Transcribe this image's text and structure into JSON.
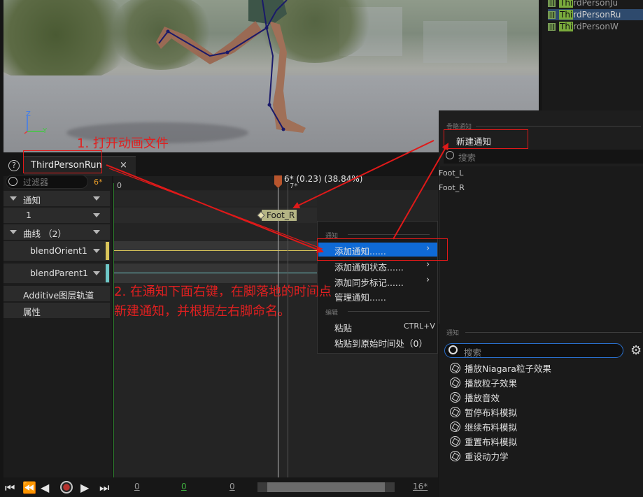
{
  "outliner": {
    "items": [
      {
        "prefix": "Thi",
        "rest": "rdPersonJu",
        "selected": false
      },
      {
        "prefix": "Thi",
        "rest": "rdPersonRu",
        "selected": true
      },
      {
        "prefix": "Thi",
        "rest": "rdPersonW",
        "selected": false
      }
    ]
  },
  "viewport": {
    "axis_z": "Z",
    "axis_y": "Y"
  },
  "tab": {
    "help": "?",
    "label": "ThirdPersonRun",
    "close": "×"
  },
  "timeline": {
    "filter_placeholder": "过滤器",
    "frame_count": "6*",
    "ruler_start": "0",
    "ruler_next": "7*",
    "scrub_label": "6* (0.23) (38.84%)",
    "tracks": {
      "notifies_label": "通知",
      "notify_track_1": "1",
      "curves_label": "曲线 （2）",
      "curve_1": "blendOrient1",
      "curve_2": "blendParent1",
      "additive": "Additive图层轨道",
      "attributes": "属性"
    },
    "notify_marker": "Foot_R",
    "curve_colors": {
      "curve_1": "#d8c45a",
      "curve_2": "#6ec7c7"
    }
  },
  "transport": {
    "num_1": "0",
    "num_2": "0",
    "num_3": "0",
    "num_end": "16*"
  },
  "context_menu": {
    "section_notify": "通知",
    "add_notify": "添加通知......",
    "add_notify_state": "添加通知状态......",
    "add_sync_marker": "添加同步标记......",
    "manage_notifies": "管理通知......",
    "section_edit": "编辑",
    "paste": "粘贴",
    "paste_shortcut": "CTRL+V",
    "paste_original_time": "粘贴到原始时间处（0）"
  },
  "submenu": {
    "section_skeleton": "骨骼通知",
    "new_notify": "新建通知",
    "search_placeholder": "搜索",
    "items": [
      "Foot_L",
      "Foot_R"
    ]
  },
  "notify_library": {
    "section": "通知",
    "search_placeholder": "搜索",
    "items": [
      "播放Niagara粒子效果",
      "播放粒子效果",
      "播放音效",
      "暂停布料模拟",
      "继续布料模拟",
      "重置布料模拟",
      "重设动力学"
    ]
  },
  "annotations": {
    "step1": "1. 打开动画文件",
    "step2_line1": "2. 在通知下面右键，在脚落地的时间点",
    "step2_line2": "新建通知，并根据左右脚命名。",
    "color": "#e01919"
  }
}
